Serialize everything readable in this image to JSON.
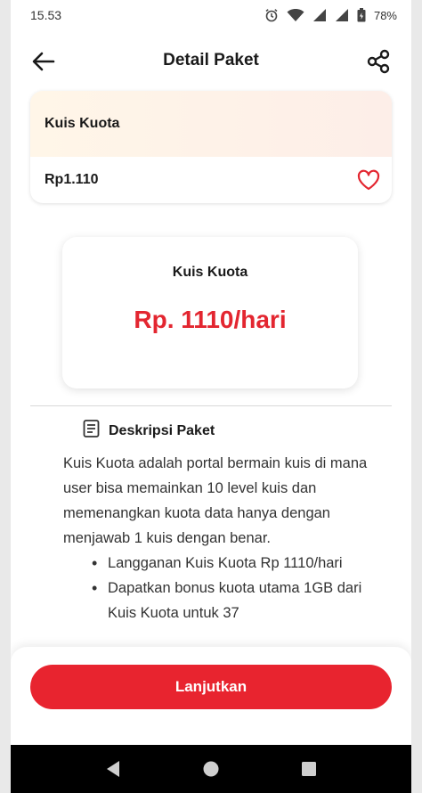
{
  "status_bar": {
    "time": "15.53",
    "battery": "78%"
  },
  "header": {
    "title": "Detail Paket"
  },
  "package_card": {
    "name": "Kuis Kuota",
    "price": "Rp1.110"
  },
  "price_box": {
    "name": "Kuis Kuota",
    "amount": "Rp. 1110/hari"
  },
  "description": {
    "heading": "Deskripsi Paket",
    "paragraph": "Kuis Kuota adalah portal bermain kuis di mana user bisa memainkan 10 level kuis dan memenangkan kuota data hanya dengan menjawab 1 kuis dengan benar.",
    "bullets": [
      "Langganan Kuis Kuota Rp 1110/hari",
      "Dapatkan bonus kuota utama 1GB dari Kuis Kuota untuk 37"
    ]
  },
  "cta": {
    "label": "Lanjutkan"
  },
  "colors": {
    "accent": "#e8242f",
    "price_text": "#e32630"
  },
  "icons": {
    "status": [
      "alarm-icon",
      "wifi-icon",
      "signal-icon",
      "signal-icon",
      "battery-icon"
    ],
    "header": [
      "back-arrow-icon",
      "share-icon"
    ],
    "nav": [
      "nav-back-icon",
      "nav-home-icon",
      "nav-recents-icon"
    ]
  }
}
